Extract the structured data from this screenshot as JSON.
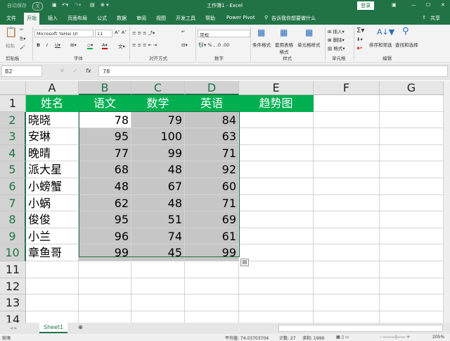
{
  "titlebar": {
    "autosave": "自动保存",
    "autosave_state": "关",
    "title": "工作簿1 - Excel",
    "login": "登录"
  },
  "tabs": [
    "文件",
    "开始",
    "插入",
    "页面布局",
    "公式",
    "数据",
    "审阅",
    "视图",
    "开发工具",
    "帮助",
    "Power Pivot"
  ],
  "tell_me": "告诉我你想要做什么",
  "share": "共享",
  "ribbon": {
    "paste": "粘贴",
    "font_name": "Microsoft YaHei UI",
    "font_size": "11",
    "number_format": "常规",
    "conditional": "条件格式",
    "table_format": "套用表格格式",
    "cell_style": "单元格样式",
    "insert": "插入",
    "delete": "删除",
    "format": "格式",
    "sort": "排序和筛选",
    "find": "查找和选择",
    "groups": [
      "剪贴板",
      "字体",
      "对齐方式",
      "数字",
      "样式",
      "单元格",
      "编辑"
    ]
  },
  "formula_bar": {
    "name_box": "B2",
    "formula": "78"
  },
  "columns": [
    "A",
    "B",
    "C",
    "D",
    "E",
    "F",
    "G"
  ],
  "rows": [
    "1",
    "2",
    "3",
    "4",
    "5",
    "6",
    "7",
    "8",
    "9",
    "10",
    "11",
    "12",
    "13",
    "14"
  ],
  "table": {
    "headers": [
      "姓名",
      "语文",
      "数学",
      "英语",
      "趋势图"
    ],
    "data": [
      [
        "晓晓",
        "78",
        "79",
        "84"
      ],
      [
        "安琳",
        "95",
        "100",
        "63"
      ],
      [
        "晚晴",
        "77",
        "99",
        "71"
      ],
      [
        "派大星",
        "68",
        "48",
        "92"
      ],
      [
        "小螃蟹",
        "48",
        "67",
        "60"
      ],
      [
        "小蜗",
        "62",
        "48",
        "71"
      ],
      [
        "俊俊",
        "95",
        "51",
        "69"
      ],
      [
        "小兰",
        "96",
        "74",
        "61"
      ],
      [
        "章鱼哥",
        "99",
        "45",
        "99"
      ]
    ]
  },
  "sheet_tab": "Sheet1",
  "status": {
    "ready": "就绪",
    "average": "平均值: 74.03703704",
    "count": "计数: 27",
    "sum": "求和: 1999",
    "zoom": "205%"
  },
  "colors": {
    "ribbon": "#217346",
    "header_fill": "#00b050",
    "selection": "#c6c6c6"
  }
}
